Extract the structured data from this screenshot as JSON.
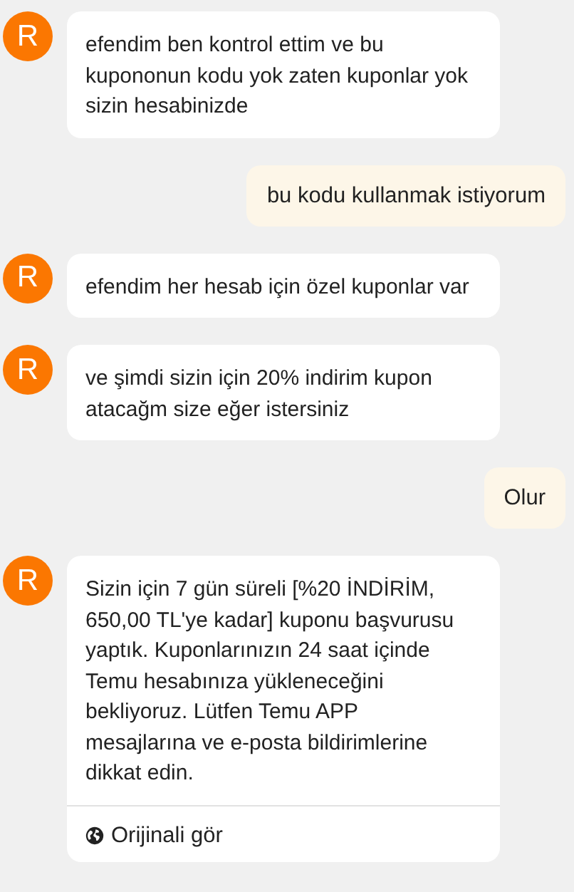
{
  "messages": [
    {
      "kind": "agent",
      "avatar": "R",
      "text": "efendim ben kontrol ettim ve bu kupononun kodu yok zaten kuponlar yok sizin hesabinizde"
    },
    {
      "kind": "user",
      "text": "bu kodu kullanmak istiyorum"
    },
    {
      "kind": "agent",
      "avatar": "R",
      "text": "efendim her hesab için özel kuponlar var"
    },
    {
      "kind": "agent",
      "avatar": "R",
      "text": "ve şimdi sizin için 20% indirim kupon atacağm size eğer istersiniz"
    },
    {
      "kind": "user",
      "text": "Olur"
    },
    {
      "kind": "agent",
      "avatar": "R",
      "text": "Sizin için 7 gün süreli [%20 İNDİRİM, 650,00 TL'ye kadar] kuponu başvurusu yaptık. Kuponlarınızın 24 saat içinde Temu hesabınıza yükleneceğini bekliyoruz. Lütfen Temu APP mesajlarına ve e-posta bildirimlerine dikkat edin.",
      "footer_link": "Orijinali gör"
    }
  ]
}
